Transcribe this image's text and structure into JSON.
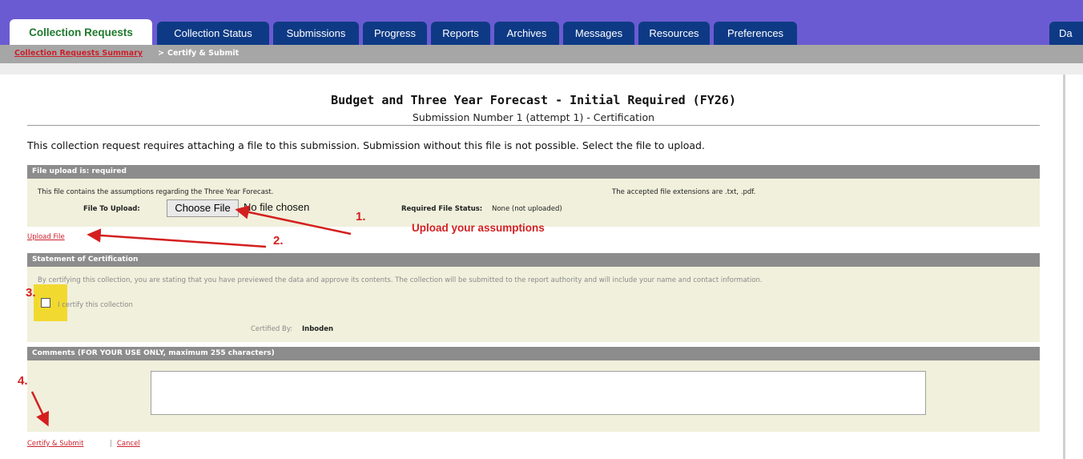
{
  "tabs": [
    {
      "label": "Collection Requests",
      "active": true
    },
    {
      "label": "Collection Status"
    },
    {
      "label": "Submissions"
    },
    {
      "label": "Progress"
    },
    {
      "label": "Reports"
    },
    {
      "label": "Archives"
    },
    {
      "label": "Messages"
    },
    {
      "label": "Resources"
    },
    {
      "label": "Preferences"
    },
    {
      "label": "Da"
    }
  ],
  "breadcrumb": {
    "link": "Collection Requests Summary",
    "separator": ">",
    "current": "Certify & Submit"
  },
  "page": {
    "title": "Budget and Three Year Forecast - Initial Required (FY26)",
    "subtitle": "Submission Number 1 (attempt 1) - Certification",
    "intro": "This collection request requires attaching a file to this submission. Submission without this file is not possible. Select the file to upload."
  },
  "upload": {
    "header": "File upload is: required",
    "description": "This file contains the assumptions regarding the Three Year Forecast.",
    "extensions": "The accepted file extensions are .txt, .pdf.",
    "file_label": "File To Upload:",
    "choose_button": "Choose File",
    "no_file": "No file chosen",
    "status_label": "Required File Status:",
    "status_value": "None (not uploaded)",
    "upload_link": "Upload File"
  },
  "certification": {
    "header": "Statement of Certification",
    "statement": "By certifying this collection, you are stating that you have previewed the data and approve its contents. The collection will be submitted to the report authority and will include your name and contact information.",
    "checkbox_label": "I certify this collection",
    "certified_by_label": "Certified By:",
    "certified_by_value": "Inboden"
  },
  "comments": {
    "header": "Comments (FOR YOUR USE ONLY, maximum 255 characters)",
    "value": ""
  },
  "actions": {
    "certify_submit": "Certify & Submit",
    "separator": "|",
    "cancel": "Cancel"
  },
  "annotations": {
    "step1": "1.",
    "step2": "2.",
    "step3": "3.",
    "step4": "4.",
    "note": "Upload your assumptions",
    "color": "#d41f1f"
  },
  "colors": {
    "tabbar": "#6b5bd2",
    "tab": "#0e3a85",
    "active_tab_text": "#1f7a2e",
    "section_header": "#8c8c8c",
    "section_body": "#f0f0dc",
    "link": "#cc1f2a"
  }
}
